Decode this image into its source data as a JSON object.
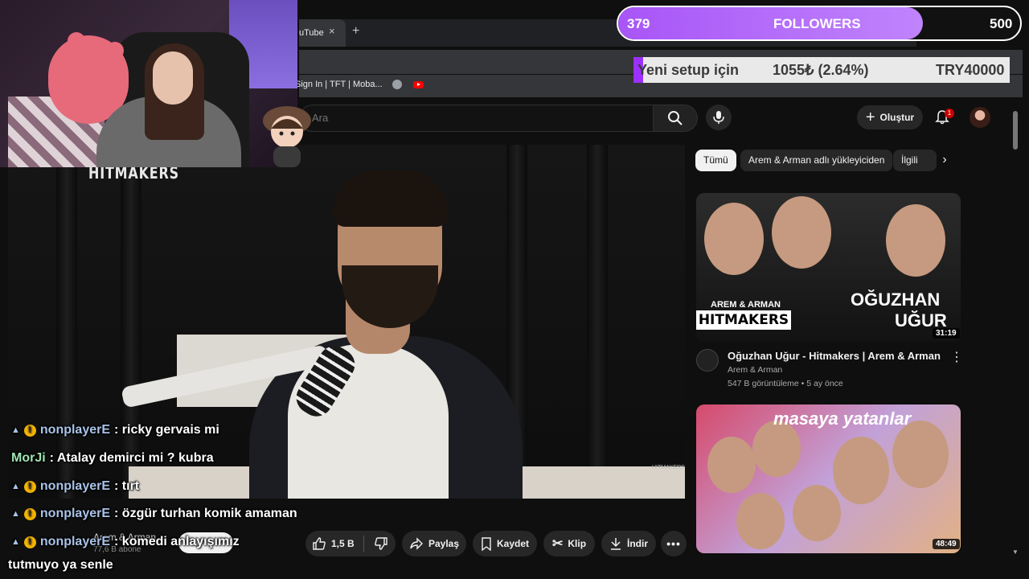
{
  "browser": {
    "tab_title": "uTube",
    "tab_close": "×",
    "new_tab": "+",
    "bookmark_label": "Sign In | TFT | Moba..."
  },
  "youtube": {
    "search_placeholder": "Ara",
    "create_label": "Oluştur",
    "notification_count": "1",
    "chips": [
      "Tümü",
      "Arem & Arman adlı yükleyiciden",
      "İlgili"
    ],
    "channel_name": "Arem & Arman",
    "channel_subs": "77,6 B abone",
    "actions": {
      "like_count": "1,5 B",
      "share": "Paylaş",
      "save": "Kaydet",
      "clip": "Klip",
      "download": "İndir"
    },
    "video_logo": "HITMAKERS",
    "video_watermark": "HITMAKERS",
    "recommendations": [
      {
        "title": "Oğuzhan Uğur - Hitmakers | Arem & Arman",
        "channel": "Arem & Arman",
        "meta": "547 B görüntüleme • 5 ay önce",
        "duration": "31:19",
        "thumb_text": [
          "AREM & ARMAN",
          "HITMAKERS",
          "OĞUZHAN",
          "UĞUR"
        ]
      },
      {
        "title": "",
        "duration": "48:49",
        "thumb_text": [
          "masaya yatanlar"
        ]
      }
    ]
  },
  "overlay": {
    "followers": {
      "current": "379",
      "label": "FOLLOWERS",
      "goal": "500",
      "progress": 0.758
    },
    "donation": {
      "label": "Yeni setup için",
      "amount": "1055₺ (2.64%)",
      "goal": "TRY40000",
      "progress": 0.0264
    }
  },
  "chat": [
    {
      "user": "nonplayerE",
      "message": ": ricky gervais mi",
      "badge": "!"
    },
    {
      "user": "MorJi",
      "message": ": Atalay demirci mi ? kubra",
      "badge": ""
    },
    {
      "user": "nonplayerE",
      "message": ": tırt",
      "badge": "!"
    },
    {
      "user": "nonplayerE",
      "message": ": özgür turhan komik amaman",
      "badge": "!"
    },
    {
      "user": "nonplayerE",
      "message": ": komedi anlayışımız",
      "badge": "!"
    },
    {
      "user": "",
      "message": "tutmuyo ya senle",
      "badge": ""
    }
  ]
}
